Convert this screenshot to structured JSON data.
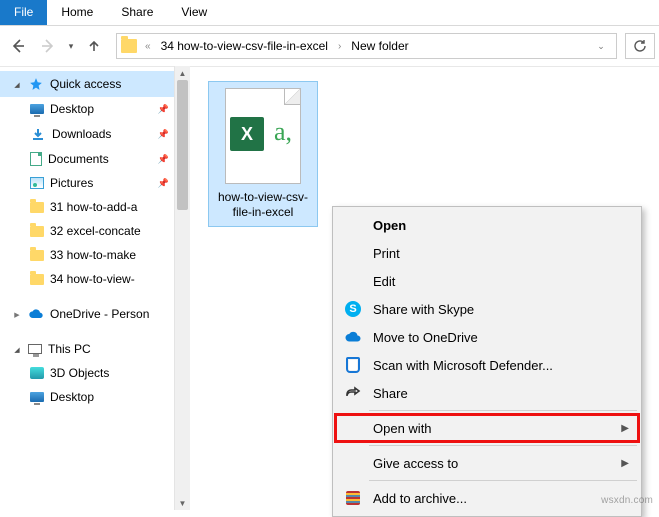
{
  "ribbon": {
    "file": "File",
    "home": "Home",
    "share": "Share",
    "view": "View"
  },
  "breadcrumb": {
    "lead": "«",
    "seg1": "34 how-to-view-csv-file-in-excel",
    "seg2": "New folder"
  },
  "sidebar": {
    "quick_access": "Quick access",
    "desktop": "Desktop",
    "downloads": "Downloads",
    "documents": "Documents",
    "pictures": "Pictures",
    "folders": [
      "31 how-to-add-a",
      "32 excel-concate",
      "33 how-to-make",
      "34 how-to-view-"
    ],
    "onedrive": "OneDrive - Person",
    "this_pc": "This PC",
    "tpc_items": [
      "3D Objects",
      "Desktop"
    ]
  },
  "file": {
    "name": "how-to-view-csv-file-in-excel",
    "thumb_text": "a,"
  },
  "context": {
    "open": "Open",
    "print": "Print",
    "edit": "Edit",
    "skype": "Share with Skype",
    "onedrive": "Move to OneDrive",
    "defender": "Scan with Microsoft Defender...",
    "share": "Share",
    "open_with": "Open with",
    "give_access": "Give access to",
    "add_archive": "Add to archive..."
  },
  "watermark": "wsxdn.com"
}
